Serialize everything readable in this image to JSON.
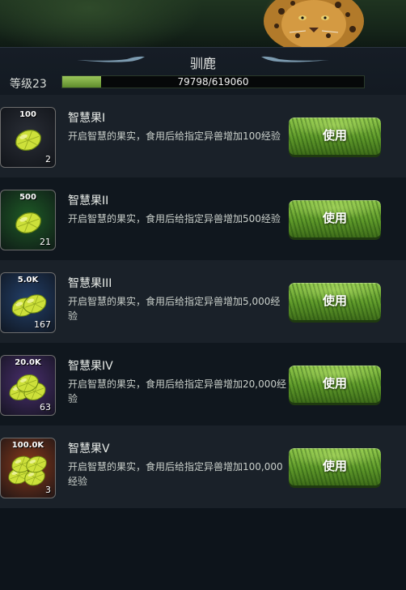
{
  "header": {
    "title": "驯鹿",
    "level_label": "等级23",
    "xp_text": "79798/619060",
    "xp_fraction": 0.129
  },
  "items": [
    {
      "name": "智慧果I",
      "desc": "开启智慧的果实，食用后给指定异兽增加100经验",
      "badge": "100",
      "count": "2",
      "button": "使用",
      "bg": "#2a2e36",
      "fruits": 1
    },
    {
      "name": "智慧果II",
      "desc": "开启智慧的果实，食用后给指定异兽增加500经验",
      "badge": "500",
      "count": "21",
      "button": "使用",
      "bg": "#1e5a26",
      "fruits": 1
    },
    {
      "name": "智慧果III",
      "desc": "开启智慧的果实，食用后给指定异兽增加5,000经验",
      "badge": "5.0K",
      "count": "167",
      "button": "使用",
      "bg": "#23406a",
      "fruits": 2
    },
    {
      "name": "智慧果IV",
      "desc": "开启智慧的果实，食用后给指定异兽增加20,000经验",
      "badge": "20.0K",
      "count": "63",
      "button": "使用",
      "bg": "#4a2f6e",
      "fruits": 3
    },
    {
      "name": "智慧果V",
      "desc": "开启智慧的果实，食用后给指定异兽增加100,000经验",
      "badge": "100.0K",
      "count": "3",
      "button": "使用",
      "bg": "#8a3a1c",
      "fruits": 4
    }
  ]
}
